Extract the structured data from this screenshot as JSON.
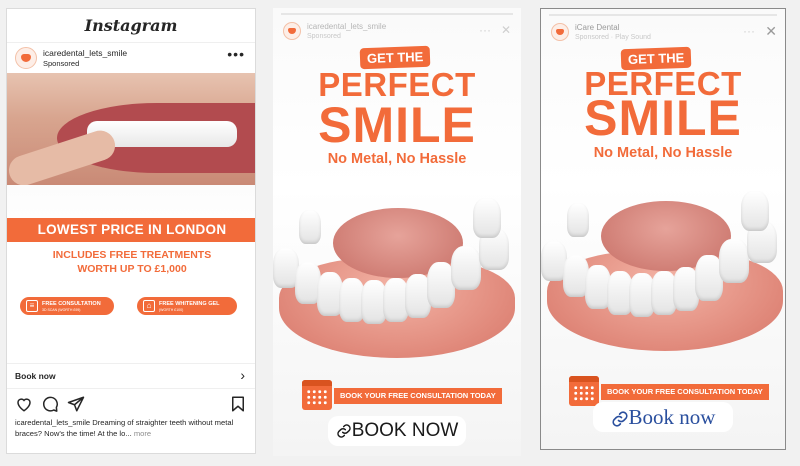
{
  "feed": {
    "app_logo": "Instagram",
    "handle": "icaredental_lets_smile",
    "sponsored": "Sponsored",
    "banner_title": "LOWEST PRICE IN LONDON",
    "banner_sub_line1": "INCLUDES FREE TREATMENTS",
    "banner_sub_line2": "WORTH UP TO £1,000",
    "badge_consult_title": "FREE CONSULTATION",
    "badge_consult_sub": "3D SCAN (WORTH £95)",
    "badge_whitening_title": "FREE WHITENING GEL",
    "badge_whitening_sub": "(WORTH £100)",
    "cta_label": "Book now",
    "caption_handle": "icaredental_lets_smile",
    "caption_text": " Dreaming of straighter teeth without metal braces? Now's the time! At the lo...",
    "caption_more": "more",
    "accent": "#f26b3a"
  },
  "story1": {
    "handle": "icaredental_lets_smile",
    "sponsored": "Sponsored",
    "tag": "GET THE",
    "headline": "PERFECT",
    "headline_big": "SMILE",
    "subhead": "No Metal, No Hassle",
    "consult_label": "BOOK YOUR  FREE CONSULTATION TODAY",
    "cta_label": "BOOK NOW"
  },
  "story2": {
    "handle": "iCare Dental",
    "sponsored": "Sponsored · Play Sound",
    "tag": "GET THE",
    "headline": "PERFECT",
    "headline_big": "SMILE",
    "subhead": "No Metal, No Hassle",
    "consult_label": "BOOK YOUR  FREE CONSULTATION TODAY",
    "cta_label": "Book now"
  }
}
